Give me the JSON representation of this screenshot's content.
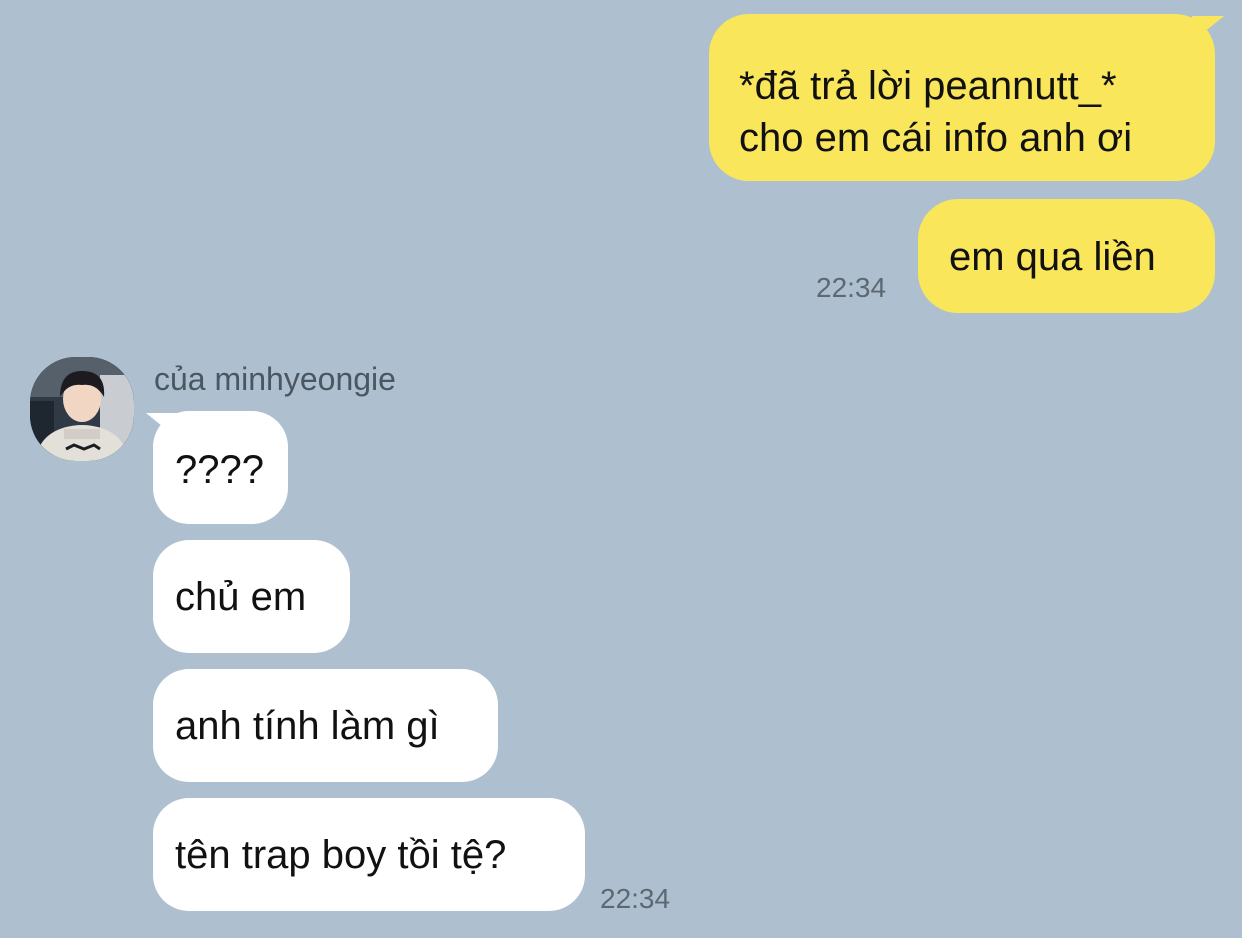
{
  "chat": {
    "outgoing": {
      "messages": [
        {
          "lines": [
            "*đã trả lời peannutt_*",
            "cho em cái info anh ơi"
          ]
        },
        {
          "lines": [
            "em qua liền"
          ]
        }
      ],
      "time": "22:34",
      "bubble_color": "#f9e65a"
    },
    "incoming": {
      "sender": "của minhyeongie",
      "messages": [
        {
          "text": "????"
        },
        {
          "text": "chủ em"
        },
        {
          "text": "anh tính làm gì"
        },
        {
          "text": "tên trap boy tồi tệ?"
        }
      ],
      "time": "22:34",
      "bubble_color": "#ffffff"
    },
    "background_color": "#aec0cf"
  }
}
